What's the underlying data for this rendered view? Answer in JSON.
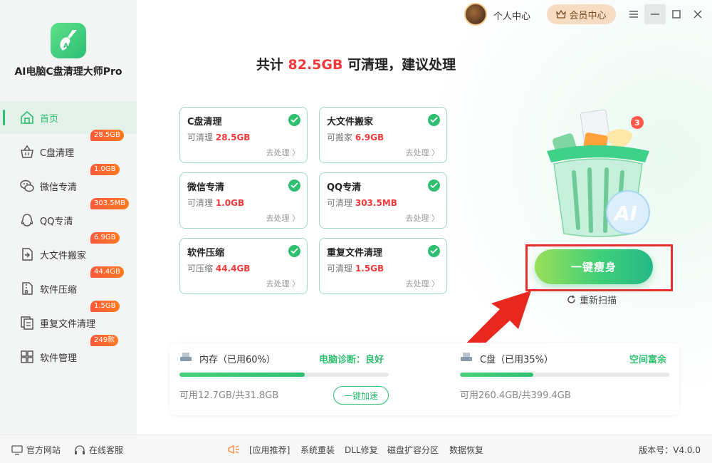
{
  "app": {
    "title": "AI电脑C盘清理大师Pro",
    "accent": "#2fbf71",
    "alert": "#f0393a"
  },
  "topbar": {
    "profile_label": "个人中心",
    "vip_label": "会员中心"
  },
  "sidebar": {
    "items": [
      {
        "label": "首页",
        "icon": "home-icon"
      },
      {
        "label": "C盘清理",
        "badge": "28.5GB",
        "icon": "basket-icon"
      },
      {
        "label": "微信专清",
        "badge": "1.0GB",
        "icon": "wechat-icon"
      },
      {
        "label": "QQ专清",
        "badge": "303.5MB",
        "icon": "qq-icon"
      },
      {
        "label": "大文件搬家",
        "badge": "6.9GB",
        "icon": "move-file-icon"
      },
      {
        "label": "软件压缩",
        "badge": "44.4GB",
        "icon": "zip-icon"
      },
      {
        "label": "重复文件清理",
        "badge": "1.5GB",
        "icon": "duplicate-icon"
      },
      {
        "label": "软件管理",
        "badge": "249款",
        "icon": "apps-grid-icon"
      }
    ]
  },
  "headline": {
    "prefix": "共计 ",
    "amount": "82.5GB",
    "suffix": " 可清理，建议处理"
  },
  "cards": [
    {
      "title": "C盘清理",
      "label": "可清理",
      "value": "28.5GB",
      "link": "去处理 〉"
    },
    {
      "title": "大文件搬家",
      "label": "可搬家",
      "value": "6.9GB",
      "link": "去处理 〉"
    },
    {
      "title": "微信专清",
      "label": "可清理",
      "value": "1.0GB",
      "link": "去处理 〉"
    },
    {
      "title": "QQ专清",
      "label": "可清理",
      "value": "303.5MB",
      "link": "去处理 〉"
    },
    {
      "title": "软件压缩",
      "label": "可压缩",
      "value": "44.4GB",
      "link": "去处理 〉"
    },
    {
      "title": "重复文件清理",
      "label": "可清理",
      "value": "1.5GB",
      "link": "去处理 〉"
    }
  ],
  "action": {
    "slim_label": "一键瘦身",
    "rescan_label": "重新扫描",
    "illustration_badge": "3"
  },
  "status": {
    "memory": {
      "label": "内存（已用60%）",
      "diagnosis": "电脑诊断：良好",
      "usage": "可用12.7GB/共31.8GB",
      "percent": 60,
      "button": "一键加速"
    },
    "disk": {
      "label": "C盘（已用35%）",
      "diagnosis": "空间富余",
      "usage": "可用260.4GB/共399.4GB",
      "percent": 35
    }
  },
  "footer": {
    "website": "官方网站",
    "service": "在线客服",
    "links": [
      "[应用推荐]",
      "系统重装",
      "DLL修复",
      "磁盘扩容分区",
      "数据恢复"
    ],
    "version": "版本号：V4.0.0"
  }
}
